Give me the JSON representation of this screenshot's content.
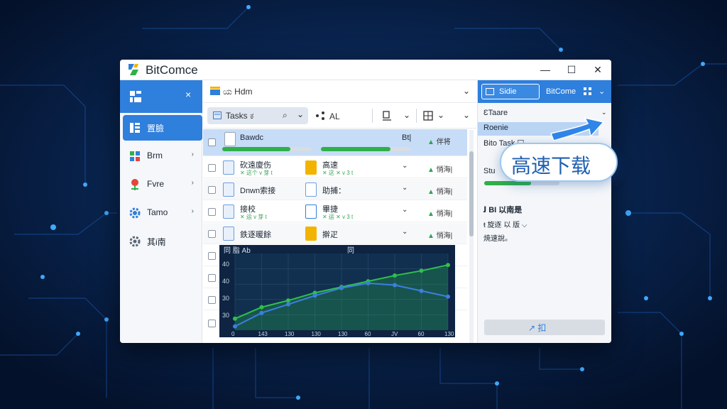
{
  "app": {
    "title": "BitComce"
  },
  "colors": {
    "accent": "#2f7fdc",
    "progress": "#2fb04a",
    "badge_text": "#1f5fb0"
  },
  "window_controls": {
    "minimize": "—",
    "maximize": "☐",
    "close": "✕"
  },
  "sidebar": {
    "close": "×",
    "items": [
      {
        "label": "置臉",
        "icon": "list-icon",
        "active": true,
        "chevron": ""
      },
      {
        "label": "Brm",
        "icon": "grid-icon",
        "active": false,
        "chevron": "›"
      },
      {
        "label": "Fvre",
        "icon": "pin-icon",
        "active": false,
        "chevron": "›"
      },
      {
        "label": "Tamo",
        "icon": "gear-icon",
        "active": false,
        "chevron": "›"
      },
      {
        "label": "其i南",
        "icon": "settings-icon",
        "active": false,
        "chevron": ""
      }
    ]
  },
  "toolbar": {
    "breadcrumb": "ಯ Hdm",
    "tasks_button": "Tasks ಕ",
    "search_chevron": "⌄",
    "all_label": "AL",
    "filter_icon": "⌕",
    "more": "⌄"
  },
  "tasks": [
    {
      "name": "Bawdc",
      "sub": "",
      "name2": "",
      "sub2": "",
      "status": "伴将",
      "extra": "Bt|",
      "progress": 0.76,
      "progress2": 0.78
    },
    {
      "name": "砍遠廈伤",
      "sub": "✕ 这个 v 芽 t",
      "name2": "高速",
      "sub2": "✕ 这 ✕ v 3 t",
      "status": "悄海|"
    },
    {
      "name": "Dnwn索接",
      "sub": "",
      "name2": "助捕：",
      "sub2": "",
      "status": "悄海|"
    },
    {
      "name": "接校",
      "sub": "✕ 运 v 芽 t",
      "name2": "畢捷",
      "sub2": "✕ 运 ✕ v 3 t",
      "status": "悄海|"
    },
    {
      "name": "鉄逐暖餘",
      "sub": "",
      "name2": "擀疋",
      "sub2": "",
      "status": "悄海|"
    }
  ],
  "chart_data": {
    "type": "area",
    "title": "同 脂 Ab",
    "title_right": "同",
    "x_ticks": [
      "0",
      "143",
      "130",
      "130",
      "130",
      "60",
      "JV",
      "60",
      "130"
    ],
    "y_ticks": [
      "40",
      "40",
      "30",
      "30"
    ],
    "series": [
      {
        "color": "#2fc04a",
        "values": [
          12,
          24,
          31,
          39,
          45,
          51,
          57,
          62,
          68
        ]
      },
      {
        "color": "#3b7fe0",
        "values": [
          4,
          18,
          27,
          36,
          44,
          49,
          47,
          41,
          35
        ]
      }
    ],
    "ylim": [
      0,
      80
    ]
  },
  "right_panel": {
    "header_left": "Sidie",
    "header_right": "BitCome",
    "header_icon": "grid-icon",
    "lines": [
      "ƐTaare",
      "Roenie",
      "Bito Task ☐",
      "Stu"
    ],
    "section_title": "ﻟ BI 以南是",
    "section_lines": [
      "ŧ 旋逐 以 版 ⌵",
      "焼速說。"
    ],
    "progress": 0.62,
    "button_label": "↗ 扣"
  },
  "badge": {
    "text": "高速下载"
  }
}
